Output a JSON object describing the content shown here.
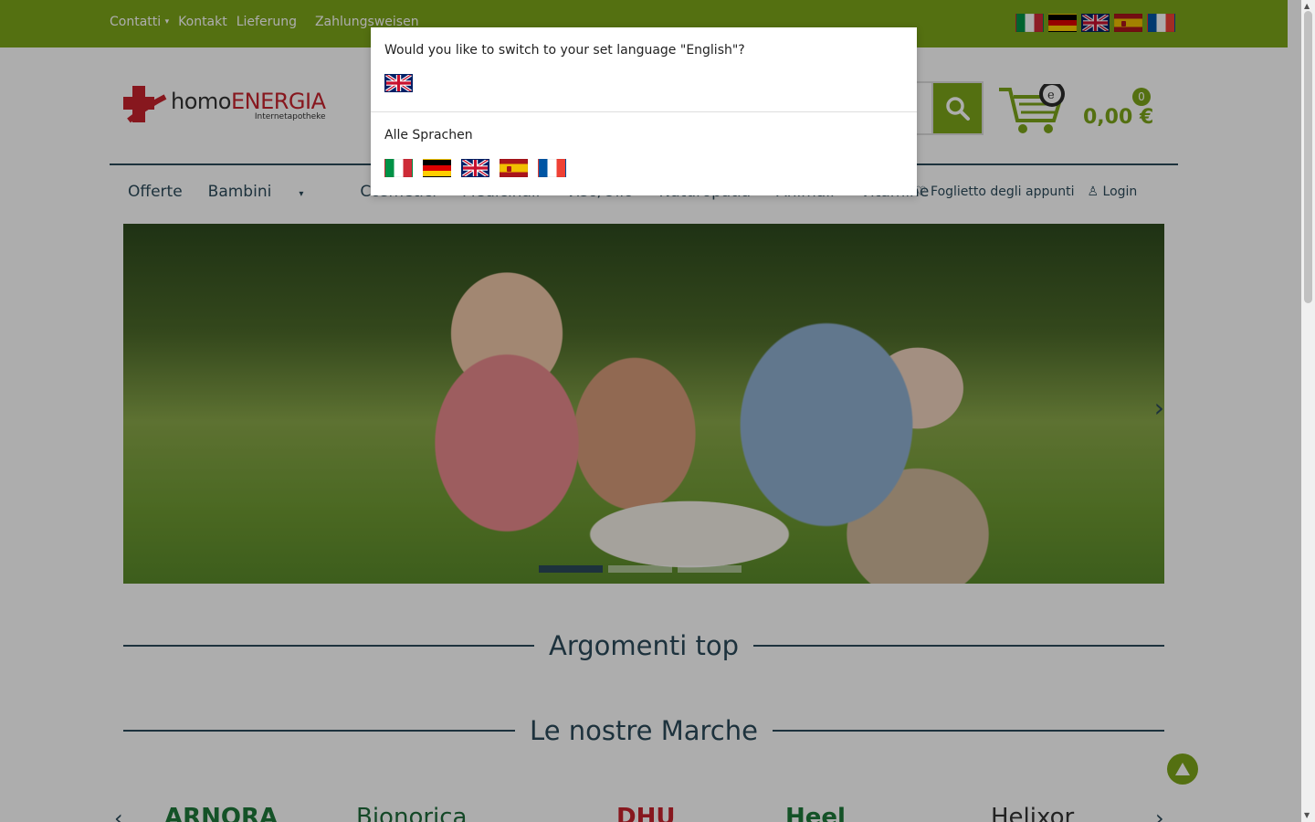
{
  "topbar": {
    "links": [
      {
        "label": "Contatti",
        "caret": "▾"
      },
      {
        "label": "Kontakt"
      },
      {
        "label": "Lieferung"
      },
      {
        "label": "Zahlungsweisen"
      }
    ],
    "flags": [
      "it",
      "de",
      "gb",
      "es",
      "fr"
    ]
  },
  "logo": {
    "brand_part1": "homo",
    "brand_part2": "ENERGIA",
    "sub": "Internetapotheke"
  },
  "cart": {
    "count": "0",
    "total": "0,00 €"
  },
  "nav": {
    "items": [
      "Offerte",
      "Bambini",
      "Cosmetici",
      "Medicinali",
      "Viso/Olio",
      "Naturopatia",
      "Animali",
      "Vitamine"
    ],
    "notepad": "Foglietto degli appunti",
    "login": "Login"
  },
  "hero": {
    "prev": "‹",
    "next": "›",
    "slides": 3,
    "active_slide": 1
  },
  "sections": {
    "top": "Argomenti top",
    "brands": "Le nostre Marche"
  },
  "brands": [
    {
      "name": "ARNORA",
      "color": "#1e7a3a"
    },
    {
      "name": "Bionorica",
      "color": "#1e6b3a"
    },
    {
      "name": "DHU",
      "color": "#c7232d"
    },
    {
      "name": "Heel",
      "color": "#1e7a3a"
    },
    {
      "name": "Helixor",
      "color": "#333333"
    }
  ],
  "modal": {
    "question": "Would you like to switch to your set language \"English\"?",
    "all_languages": "Alle Sprachen",
    "languages": [
      "it",
      "de",
      "gb",
      "es",
      "fr"
    ]
  },
  "colors": {
    "green": "#7ca51a",
    "navy": "#2c4a5a",
    "red": "#c7232d"
  }
}
